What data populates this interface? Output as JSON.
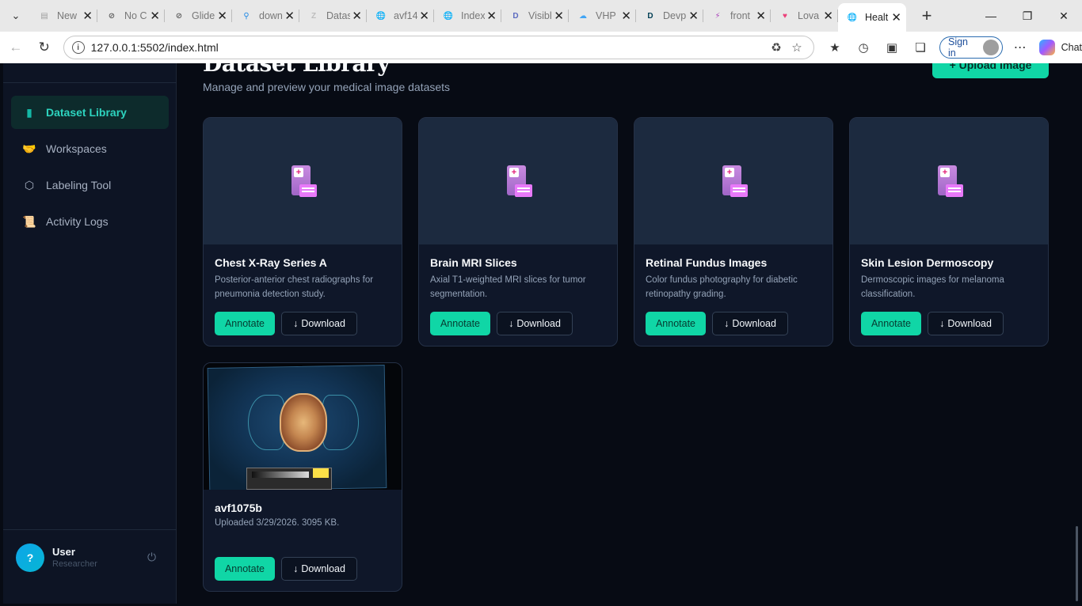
{
  "browser": {
    "tabs": [
      {
        "title": "New",
        "icon": "page-icon",
        "color": "#9e9e9e"
      },
      {
        "title": "No C",
        "icon": "blocked-icon",
        "color": "#616161"
      },
      {
        "title": "Glide",
        "icon": "blocked-icon",
        "color": "#616161"
      },
      {
        "title": "down",
        "icon": "search-icon",
        "color": "#1e88e5"
      },
      {
        "title": "Datas",
        "icon": "zb-icon",
        "color": "#bdbdbd"
      },
      {
        "title": "avf14",
        "icon": "globe-icon",
        "color": "#616161"
      },
      {
        "title": "Index",
        "icon": "globe-icon",
        "color": "#616161"
      },
      {
        "title": "Visibl",
        "icon": "d-icon",
        "color": "#5c6bc0"
      },
      {
        "title": "VHP",
        "icon": "cloud-icon",
        "color": "#42a5f5"
      },
      {
        "title": "Devp",
        "icon": "devpost-icon",
        "color": "#003e54"
      },
      {
        "title": "front",
        "icon": "bolt-icon",
        "color": "#ab47bc"
      },
      {
        "title": "Lova",
        "icon": "heart-icon",
        "color": "#ec407a"
      },
      {
        "title": "Healt",
        "icon": "globe-icon",
        "color": "#616161"
      }
    ],
    "url": "127.0.0.1:5502/index.html",
    "signin_label": "Sign in",
    "chat_label": "Chat"
  },
  "sidebar": {
    "items": [
      {
        "label": "Dataset Library",
        "icon": "dataset-icon",
        "active": true
      },
      {
        "label": "Workspaces",
        "icon": "handshake-icon",
        "active": false
      },
      {
        "label": "Labeling Tool",
        "icon": "hexagon-icon",
        "active": false
      },
      {
        "label": "Activity Logs",
        "icon": "scroll-icon",
        "active": false
      }
    ],
    "user": {
      "avatar": "?",
      "name": "User",
      "role": "Researcher"
    }
  },
  "main": {
    "title": "Dataset Library",
    "subtitle": "Manage and preview your medical image datasets",
    "upload_label": "+ Upload Image",
    "annotate_label": "Annotate",
    "download_label": "Download",
    "cards": [
      {
        "title": "Chest X-Ray Series A",
        "description": "Posterior-anterior chest radiographs for pneumonia detection study."
      },
      {
        "title": "Brain MRI Slices",
        "description": "Axial T1-weighted MRI slices for tumor segmentation."
      },
      {
        "title": "Retinal Fundus Images",
        "description": "Color fundus photography for diabetic retinopathy grading."
      },
      {
        "title": "Skin Lesion Dermoscopy",
        "description": "Dermoscopic images for melanoma classification."
      },
      {
        "title": "avf1075b",
        "description": "Uploaded 3/29/2026. 3095 KB."
      }
    ]
  },
  "colors": {
    "accent": "#10d6a6",
    "bg": "#070b14",
    "card": "#0f1729"
  }
}
